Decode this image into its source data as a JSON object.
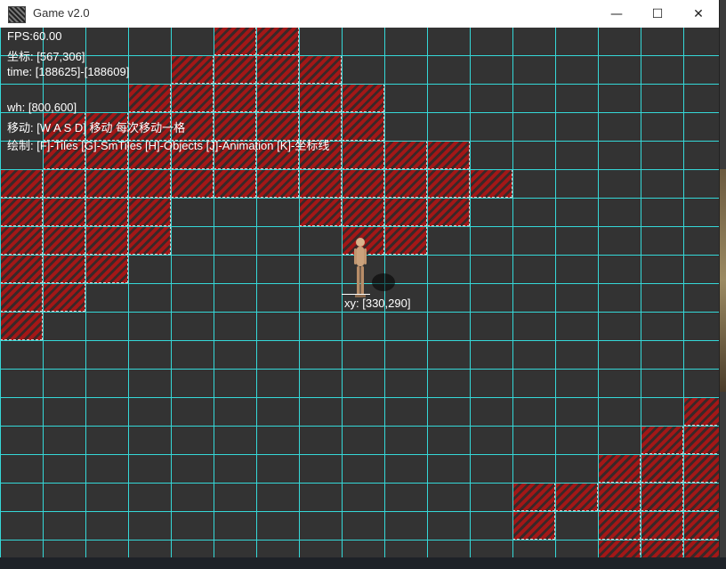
{
  "window": {
    "title": "Game v2.0",
    "icon": "game-app-icon",
    "controls": {
      "minimize": "—",
      "maximize": "☐",
      "close": "✕"
    }
  },
  "hud": {
    "fps": "FPS:60.00",
    "coords": "坐标: [567,306]",
    "time": "time: [188625]-[188609]",
    "wh": "wh: [800,600]",
    "move": "移动: [W A S D] 移动 每次移动一格",
    "draw": "绘制: [F]-Tiles [G]-SmTiles [H]-Objects [J]-Animation [K]-坐标线"
  },
  "player": {
    "xy_label": "xy: [330,290]"
  },
  "colors": {
    "grid": "#35d8d8",
    "tile_red": "#a31717",
    "background": "#333333"
  },
  "tiles": [
    [
      5,
      0
    ],
    [
      6,
      0
    ],
    [
      4,
      1
    ],
    [
      5,
      1
    ],
    [
      6,
      1
    ],
    [
      7,
      1
    ],
    [
      3,
      2
    ],
    [
      4,
      2
    ],
    [
      5,
      2
    ],
    [
      6,
      2
    ],
    [
      7,
      2
    ],
    [
      8,
      2
    ],
    [
      1,
      3
    ],
    [
      2,
      3
    ],
    [
      3,
      3
    ],
    [
      4,
      3
    ],
    [
      5,
      3
    ],
    [
      6,
      3
    ],
    [
      7,
      3
    ],
    [
      8,
      3
    ],
    [
      1,
      4
    ],
    [
      2,
      4
    ],
    [
      3,
      4
    ],
    [
      4,
      4
    ],
    [
      5,
      4
    ],
    [
      6,
      4
    ],
    [
      7,
      4
    ],
    [
      8,
      4
    ],
    [
      9,
      4
    ],
    [
      10,
      4
    ],
    [
      0,
      5
    ],
    [
      1,
      5
    ],
    [
      2,
      5
    ],
    [
      3,
      5
    ],
    [
      4,
      5
    ],
    [
      5,
      5
    ],
    [
      6,
      5
    ],
    [
      7,
      5
    ],
    [
      8,
      5
    ],
    [
      9,
      5
    ],
    [
      10,
      5
    ],
    [
      11,
      5
    ],
    [
      0,
      6
    ],
    [
      1,
      6
    ],
    [
      2,
      6
    ],
    [
      3,
      6
    ],
    [
      7,
      6
    ],
    [
      8,
      6
    ],
    [
      9,
      6
    ],
    [
      10,
      6
    ],
    [
      0,
      7
    ],
    [
      1,
      7
    ],
    [
      2,
      7
    ],
    [
      3,
      7
    ],
    [
      8,
      7
    ],
    [
      9,
      7
    ],
    [
      0,
      8
    ],
    [
      1,
      8
    ],
    [
      2,
      8
    ],
    [
      0,
      9
    ],
    [
      1,
      9
    ],
    [
      0,
      10
    ],
    [
      16,
      13
    ],
    [
      15,
      14
    ],
    [
      16,
      14
    ],
    [
      14,
      15
    ],
    [
      15,
      15
    ],
    [
      16,
      15
    ],
    [
      12,
      16
    ],
    [
      13,
      16
    ],
    [
      14,
      16
    ],
    [
      15,
      16
    ],
    [
      16,
      16
    ],
    [
      12,
      17
    ],
    [
      14,
      17
    ],
    [
      15,
      17
    ],
    [
      16,
      17
    ],
    [
      14,
      18
    ],
    [
      15,
      18
    ],
    [
      16,
      18
    ]
  ]
}
